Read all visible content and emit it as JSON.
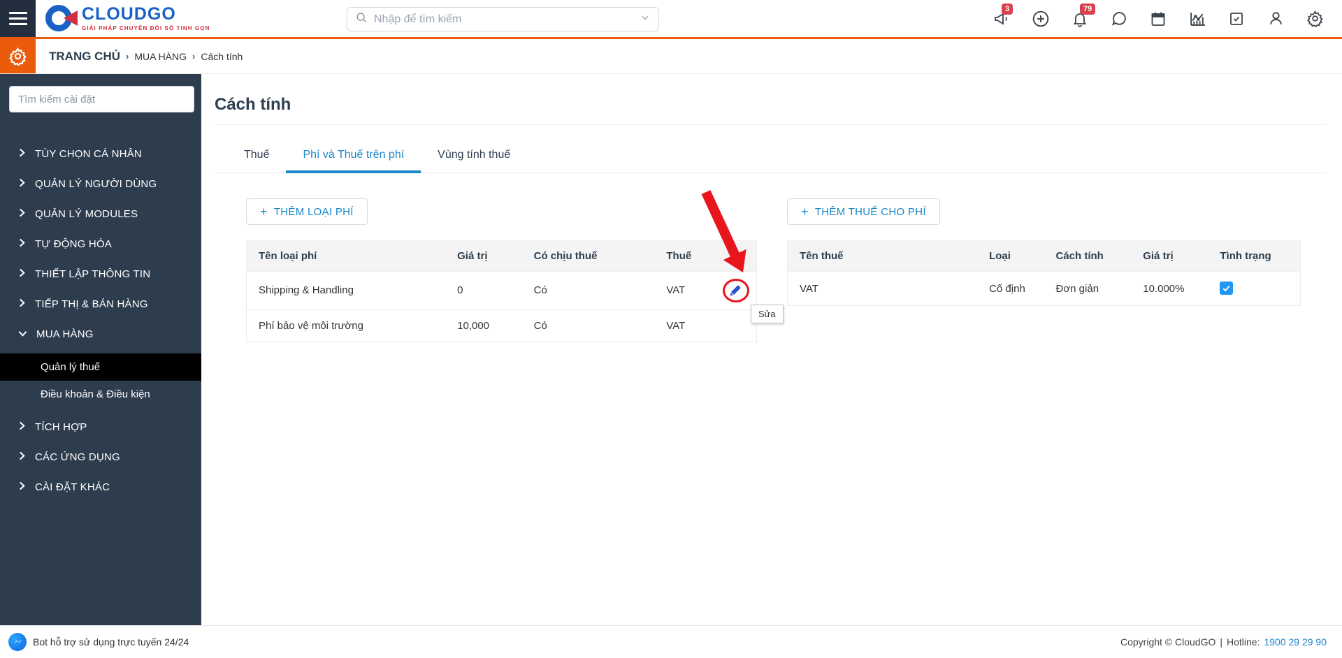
{
  "topbar": {
    "search_placeholder": "Nhập để tìm kiếm",
    "announce_badge": "3",
    "bell_badge": "79"
  },
  "logo": {
    "text": "CLOUDGO",
    "tagline": "GIẢI PHÁP CHUYỂN ĐỔI SỐ TINH GỌN"
  },
  "breadcrumb": {
    "root": "TRANG CHỦ",
    "sep": "›",
    "section": "MUA HÀNG",
    "page": "Cách tính"
  },
  "sidebar": {
    "search_placeholder": "Tìm kiếm cài đặt",
    "items": [
      {
        "label": "TÙY CHỌN CÁ NHÂN"
      },
      {
        "label": "QUẢN LÝ NGƯỜI DÙNG"
      },
      {
        "label": "QUẢN LÝ MODULES"
      },
      {
        "label": "TỰ ĐỘNG HÓA"
      },
      {
        "label": "THIẾT LẬP THÔNG TIN"
      },
      {
        "label": "TIẾP THỊ & BÁN HÀNG"
      },
      {
        "label": "MUA HÀNG"
      }
    ],
    "subitems": [
      {
        "label": "Quản lý thuế"
      },
      {
        "label": "Điều khoản & Điều kiện"
      }
    ],
    "items_after": [
      {
        "label": "TÍCH HỢP"
      },
      {
        "label": "CÁC ỨNG DỤNG"
      },
      {
        "label": "CÀI ĐẶT KHÁC"
      }
    ]
  },
  "main": {
    "title": "Cách tính",
    "tabs": [
      {
        "label": "Thuế"
      },
      {
        "label": "Phí và Thuế trên phí"
      },
      {
        "label": "Vùng tính thuế"
      }
    ],
    "fees": {
      "add_plus": "+",
      "add_label": "THÊM LOẠI PHÍ",
      "headers": [
        "Tên loại phí",
        "Giá trị",
        "Có chịu thuế",
        "Thuế"
      ],
      "rows": [
        {
          "name": "Shipping & Handling",
          "value": "0",
          "taxable": "Có",
          "tax": "VAT"
        },
        {
          "name": "Phí bảo vệ môi trường",
          "value": "10,000",
          "taxable": "Có",
          "tax": "VAT"
        }
      ],
      "edit_tooltip": "Sửa"
    },
    "taxes": {
      "add_plus": "+",
      "add_label": "THÊM THUẾ CHO PHÍ",
      "headers": [
        "Tên thuế",
        "Loại",
        "Cách tính",
        "Giá trị",
        "Tình trạng"
      ],
      "rows": [
        {
          "name": "VAT",
          "type": "Cố định",
          "method": "Đơn giản",
          "value": "10.000%",
          "status": "checked"
        }
      ]
    }
  },
  "footer": {
    "support": "Bot hỗ trợ sử dụng trực tuyến 24/24",
    "copyright": "Copyright © CloudGO",
    "divider": "|",
    "hotline_label": "Hotline:",
    "hotline_number": "1900 29 29 90"
  },
  "colors": {
    "accent_blue": "#1a87ca",
    "brand_orange": "#ea5b0c",
    "sidebar_navy": "#2e3d4e",
    "annotation_red": "#e8151d",
    "checkbox_blue": "#2196f3",
    "logo_blue": "#1961c5",
    "logo_red": "#d32f3e"
  }
}
